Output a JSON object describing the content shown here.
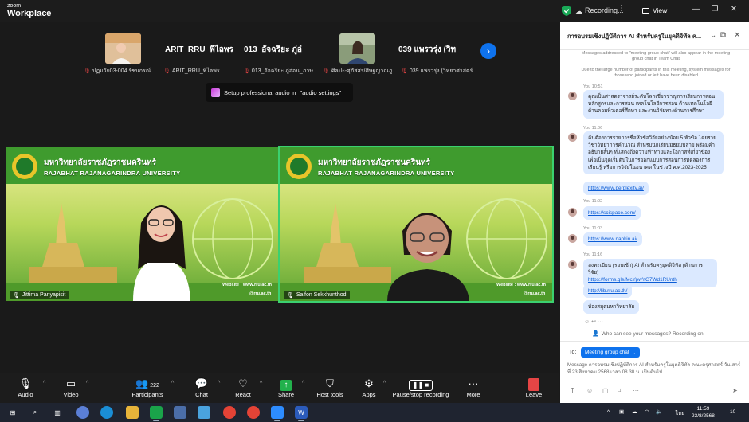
{
  "app": {
    "brand_top": "zoom",
    "brand_bottom": "Workplace"
  },
  "topbar": {
    "recording_label": "Recording...",
    "view_label": "View"
  },
  "thumbnails": [
    {
      "caption": "ปฏมวัย03-004 รัชนกรณ์"
    },
    {
      "display_name": "ARIT_RRU_พิไลพร",
      "caption": "ARIT_RRU_พิไลพร"
    },
    {
      "display_name": "013_อัจฉริยะ ภู่อ่",
      "caption": "013_อัจฉริยะ ภู่อ่อน_ภาษ..."
    },
    {
      "caption": "ศิลปะ-ศุภัสสร/ศิษฐญาณภู"
    },
    {
      "display_name": "039 แพรวรุ่ง (วิท",
      "caption": "039 แพรวรุ่ง (วิทยาศาสตร์..."
    }
  ],
  "audio_tip": {
    "text": "Setup professional audio in",
    "link": "\"audio settings\""
  },
  "videos": [
    {
      "name": "Jittima Panyapisit",
      "banner_th": "มหาวิทยาลัยราชภัฏราชนครินทร์",
      "banner_en": "RAJABHAT RAJANAGARINDRA UNIVERSITY",
      "website": "Website : www.rru.ac.th",
      "social": "@rru.ac.th"
    },
    {
      "name": "Saifon Sekkhunthod",
      "banner_th": "มหาวิทยาลัยราชภัฏราชนครินทร์",
      "banner_en": "RAJABHAT RAJANAGARINDRA UNIVERSITY",
      "website": "Website : www.rru.ac.th",
      "social": "@rru.ac.th"
    }
  ],
  "toolbar": {
    "audio": "Audio",
    "video": "Video",
    "participants": "Participants",
    "participants_count": "222",
    "chat": "Chat",
    "react": "React",
    "share": "Share",
    "host_tools": "Host tools",
    "apps": "Apps",
    "record": "Pause/stop recording",
    "more": "More",
    "leave": "Leave"
  },
  "chat": {
    "title": "การอบรมเชิงปฏิบัติการ AI สำหรับครูในยุคดิจิทัล ค...",
    "notice1": "Messages addressed to \"meeting group chat\" will also appear in the meeting group chat in Team Chat",
    "notice2": "Due to the large number of participants in this meeting, system messages for those who joined or left have been disabled",
    "messages": [
      {
        "meta": "You 10:51",
        "text": "คุณเป็นศาสตราจารย์ระดับโลกเชี่ยวชาญการเรียนการสอน หลักสูตรและการสอน เทคโนโลยีการสอน ด้านเทคโนโลยี ด้านคอมพิวเตอร์ศึกษา และงานวิจัยทางด้านการศึกษา"
      },
      {
        "meta": "You 11:06",
        "text": "ฉันต้องการรายการชื่อหัวข้อวิจัยอย่างน้อย 5 หัวข้อ โดยราย วิชาวิทยาการคำนวณ สำหรับนักเรียนมัธยมปลาย พร้อมคำ อธิบายสั้นๆ ที่แสดงถึงความท้าทายและโอกาสที่เกี่ยวข้อง เพื่อเป็นจุดเริ่มต้นในการออกแบบการสอนการทดลองการ เรียนรู้ หรือการวิจัยในอนาคต ในช่วงปี ค.ศ.2023-2025"
      },
      {
        "meta": "",
        "link": "https://www.perplexity.ai/"
      },
      {
        "meta": "You 11:02",
        "link": "https://scispace.com/"
      },
      {
        "meta": "You 11:03",
        "link": "https://www.napkin.ai/"
      },
      {
        "meta": "You 11:16",
        "text": "ลงทะเบียน (รอบเช้า) AI สำหรับครูยุคดิจิทัล (ด้านการวิจัย)",
        "link": "https://forms.gle/McYpwYG7Wd1RUnth"
      },
      {
        "meta": "",
        "link": "http://lib.rru.ac.th/"
      },
      {
        "meta": "",
        "text": "ห้องสมุดมหาวิทยาลัย"
      }
    ],
    "reactions": "☺ ↩ ···",
    "who_can_see": "Who can see your messages? Recording on",
    "to_label": "To:",
    "to_value": "Meeting group chat",
    "draft_prefix": "Message",
    "draft": "การอบรมเชิงปฏิบัติการ AI สำหรับครูในยุคดิจิทัล คณะครุศาสตร์ วันเสาร์ที่ 23 สิงหาคม 2568 เวลา 08.30 น. เป็นต้นไป"
  },
  "taskbar": {
    "lang": "ไทย",
    "time": "11:59",
    "date": "23/8/2568",
    "notif_count": "10"
  },
  "colors": {
    "accent": "#0e72ed",
    "recording": "#e64545",
    "active_speaker": "#3bd16f",
    "chat_bubble": "#dbe9ff"
  }
}
